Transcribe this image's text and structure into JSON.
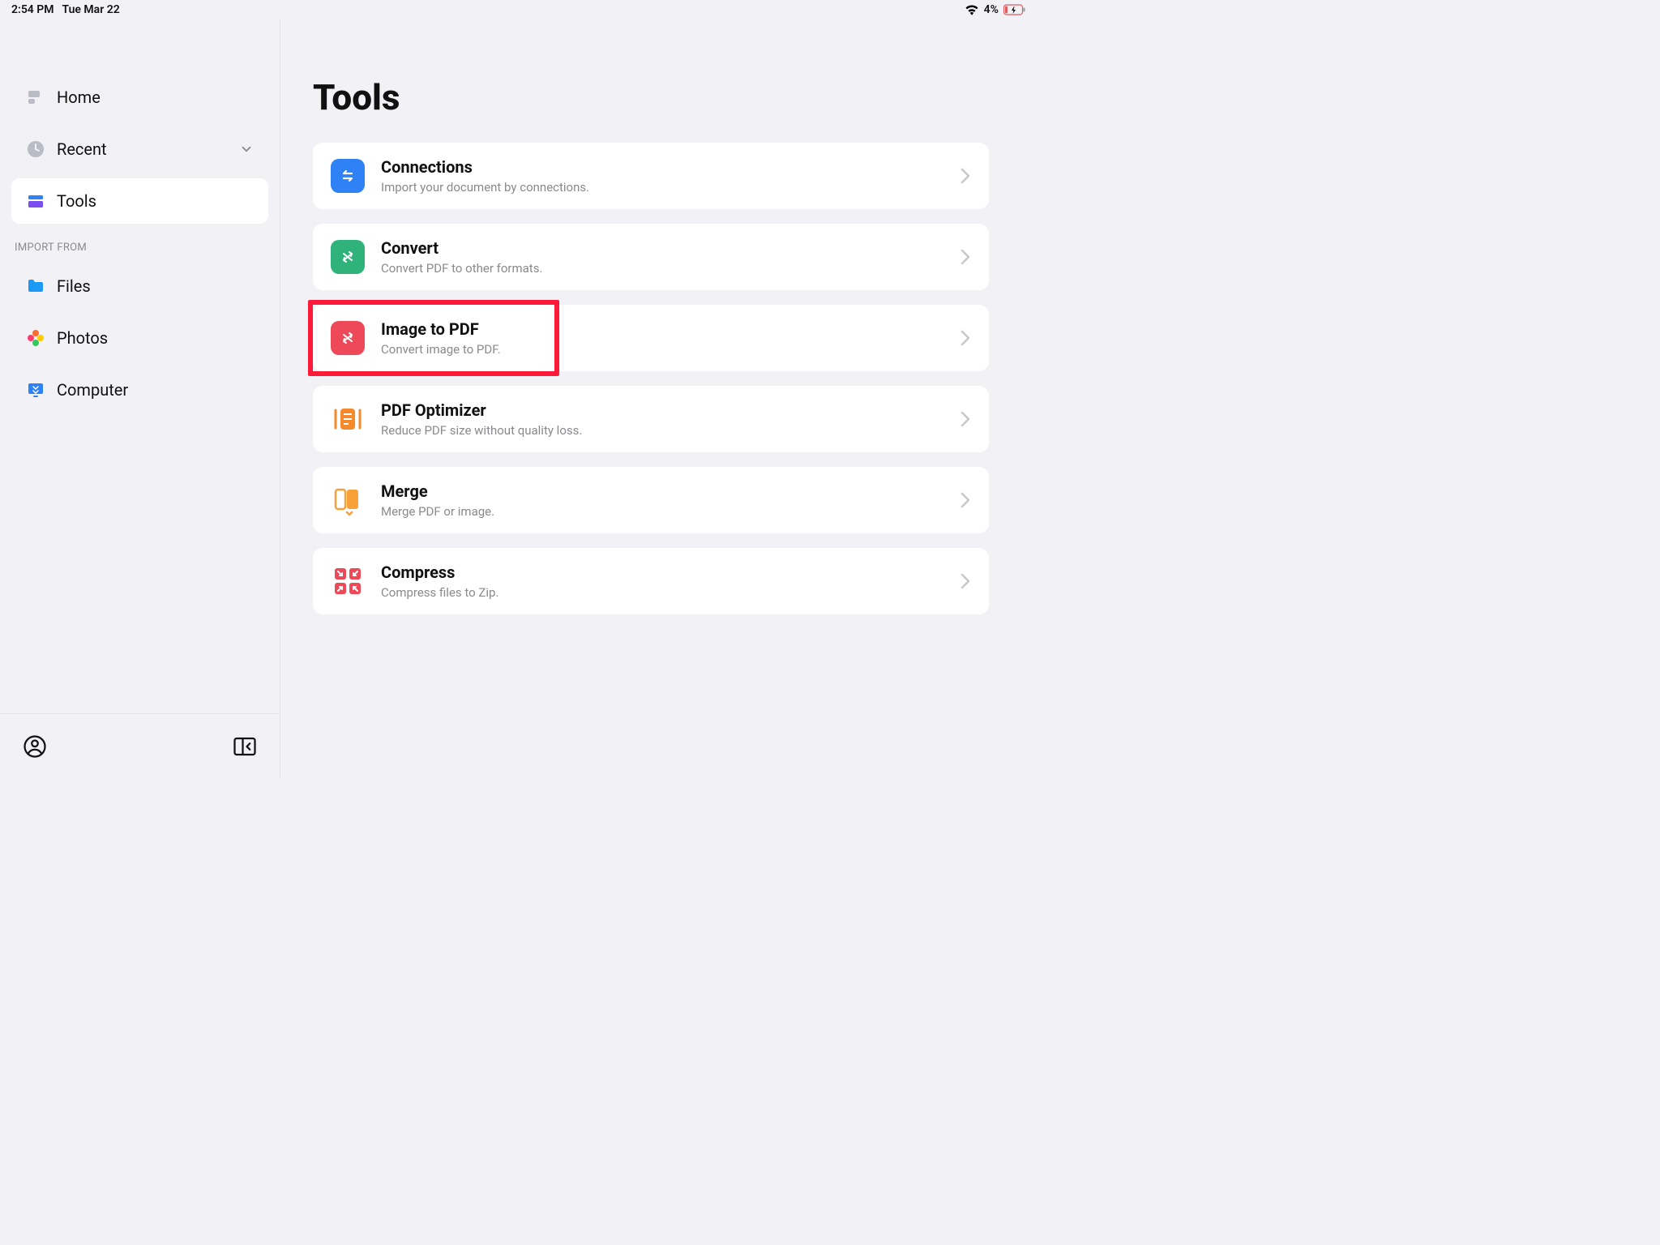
{
  "status": {
    "time": "2:54 PM",
    "date": "Tue Mar 22",
    "battery": "4%"
  },
  "sidebar": {
    "nav": [
      {
        "label": "Home"
      },
      {
        "label": "Recent"
      },
      {
        "label": "Tools"
      }
    ],
    "section_label": "IMPORT FROM",
    "import": [
      {
        "label": "Files"
      },
      {
        "label": "Photos"
      },
      {
        "label": "Computer"
      }
    ]
  },
  "main": {
    "title": "Tools",
    "tools": [
      {
        "title": "Connections",
        "sub": "Import your document by connections."
      },
      {
        "title": "Convert",
        "sub": "Convert PDF to other formats."
      },
      {
        "title": "Image to PDF",
        "sub": "Convert image to PDF."
      },
      {
        "title": "PDF Optimizer",
        "sub": "Reduce PDF size without quality loss."
      },
      {
        "title": "Merge",
        "sub": "Merge PDF or image."
      },
      {
        "title": "Compress",
        "sub": "Compress files to Zip."
      }
    ]
  }
}
